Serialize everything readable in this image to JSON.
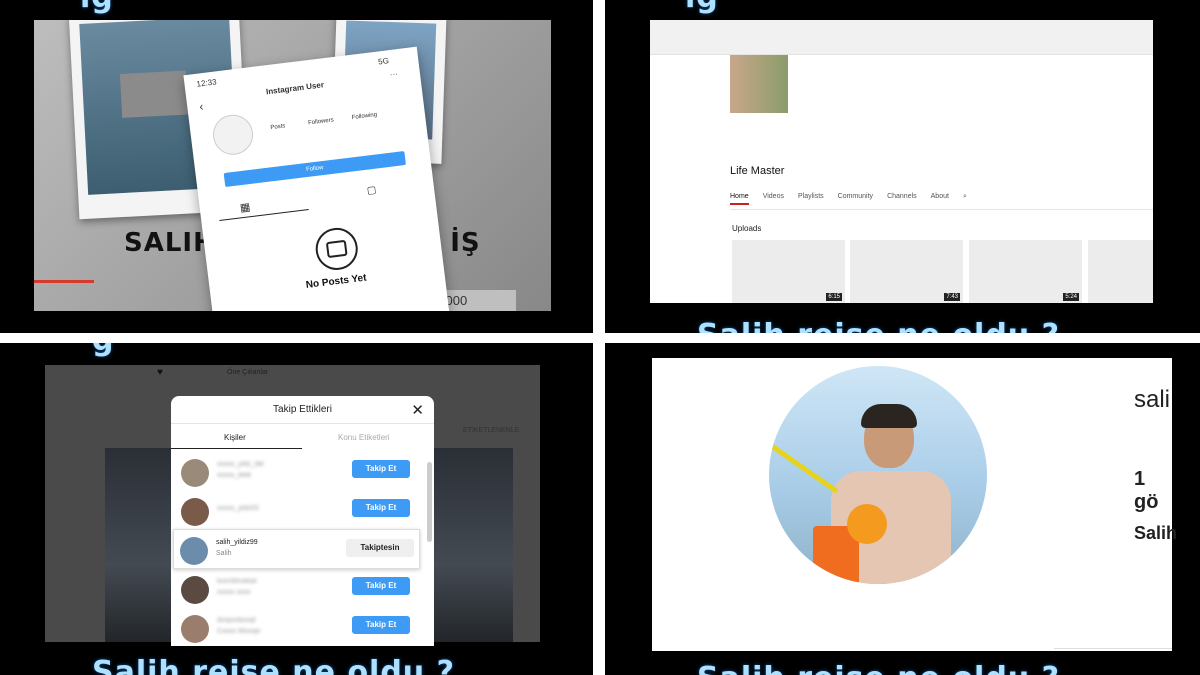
{
  "captions": {
    "q1_top": "ig",
    "q2_top": "ig",
    "q2_bottom": "Salih reise ne oldu ?",
    "q3_top": "g",
    "q3_bottom": "Salih reise ne oldu ?",
    "q4_bottom": "Salih reise ne oldu ?"
  },
  "q1": {
    "status_time": "12:33",
    "status_network": "5G",
    "profile_name": "Instagram User",
    "stats": [
      "Posts",
      "Followers",
      "Following"
    ],
    "follow_label": "Follow",
    "empty_label": "No Posts Yet",
    "headline_left": "SALIH",
    "headline_right": "K İŞ",
    "money_prefix": "ol",
    "money_value": "14.000.000"
  },
  "q2": {
    "channel_name": "Life Master",
    "tabs": [
      "Home",
      "Videos",
      "Playlists",
      "Community",
      "Channels",
      "About"
    ],
    "section": "Uploads",
    "durations": [
      "6:15",
      "7:43",
      "5:24",
      ""
    ]
  },
  "q3": {
    "page_label": "Öne Çıkanlar",
    "side_label": "ETİKETLENENLE",
    "modal_title": "Takip Ettikleri",
    "tab_people": "Kişiler",
    "tab_hashtags": "Konu Etiketleri",
    "rows": [
      {
        "username": "xxxxx_yldz_ble",
        "name": "xxxxx_blek",
        "button": "Takip Et",
        "blurred": true
      },
      {
        "username": "xxxxx_yldz03",
        "name": "",
        "button": "Takip Et",
        "blurred": true
      },
      {
        "username": "salih_yildiz99",
        "name": "Salih",
        "button": "Takiptesin",
        "blurred": false
      },
      {
        "username": "kxxrrbhukkal",
        "name": "xxxxx xxxx",
        "button": "Takip Et",
        "blurred": true
      },
      {
        "username": "dxxpsxbxxqf",
        "name": "Cxxxx Mxxxpr",
        "button": "Takip Et",
        "blurred": true
      }
    ]
  },
  "q4": {
    "name_partial": "sali",
    "count_partial": "1 gö",
    "bio_partial": "Salih"
  },
  "colors": {
    "caption": "#aee1ff",
    "ig_blue": "#3d9bf5",
    "yt_red": "#cc1f1f"
  }
}
